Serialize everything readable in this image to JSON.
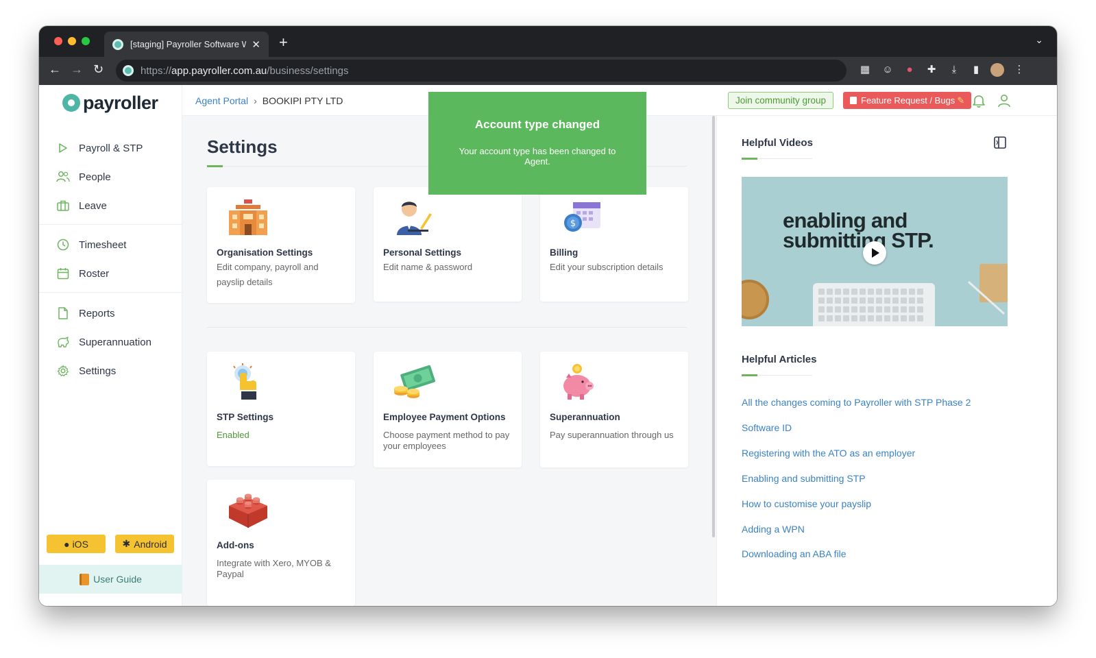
{
  "browser": {
    "tab_title": "[staging] Payroller Software W",
    "url_scheme": "https://",
    "url_host": "app.payroller.com.au",
    "url_path": "/business/settings"
  },
  "sidebar": {
    "logo_text": "payroller",
    "items": [
      {
        "label": "Payroll & STP",
        "icon": "play-icon"
      },
      {
        "label": "People",
        "icon": "people-icon"
      },
      {
        "label": "Leave",
        "icon": "briefcase-icon"
      },
      {
        "label": "Timesheet",
        "icon": "clock-icon"
      },
      {
        "label": "Roster",
        "icon": "calendar-icon"
      },
      {
        "label": "Reports",
        "icon": "document-icon"
      },
      {
        "label": "Superannuation",
        "icon": "piggy-icon"
      },
      {
        "label": "Settings",
        "icon": "gear-icon"
      }
    ],
    "ios_label": "iOS",
    "android_label": "Android",
    "user_guide_label": "User Guide"
  },
  "header": {
    "breadcrumb_parent": "Agent Portal",
    "breadcrumb_current": "BOOKIPI PTY LTD",
    "community_label": "Join community group",
    "feature_label": "Feature Request / Bugs"
  },
  "toast": {
    "title": "Account type changed",
    "message": "Your account type has been changed to Agent."
  },
  "main": {
    "title": "Settings",
    "cards": [
      {
        "title": "Organisation Settings",
        "desc": "Edit company, payroll and payslip details"
      },
      {
        "title": "Personal Settings",
        "desc": "Edit name & password"
      },
      {
        "title": "Billing",
        "desc": "Edit your subscription details"
      },
      {
        "title": "STP Settings",
        "status": "Enabled"
      },
      {
        "title": "Employee Payment Options",
        "desc": "Choose payment method to pay your employees"
      },
      {
        "title": "Superannuation",
        "desc": "Pay superannuation through us"
      },
      {
        "title": "Add-ons",
        "desc": "Integrate with Xero, MYOB & Paypal"
      }
    ]
  },
  "right_panel": {
    "videos_heading": "Helpful Videos",
    "video_caption_line1": "enabling and",
    "video_caption_line2": "submitting STP.",
    "articles_heading": "Helpful Articles",
    "articles": [
      "All the changes coming to Payroller with STP Phase 2",
      "Software ID",
      "Registering with the ATO as an employer",
      "Enabling and submitting STP",
      "How to customise your payslip",
      "Adding a WPN",
      "Downloading an ABA file"
    ]
  },
  "colors": {
    "brand_teal": "#4fb6a7",
    "accent_green": "#6cb55e",
    "toast_green": "#5cb85c",
    "link_blue": "#3b82c4",
    "feature_red": "#ea5a5a",
    "store_yellow": "#f5c332"
  }
}
